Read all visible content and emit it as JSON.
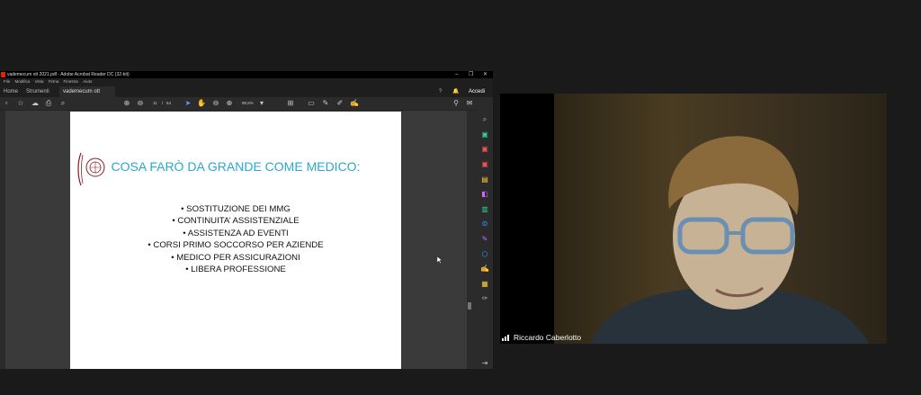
{
  "window": {
    "title": "vademecum ott 2021.pdf - Adobe Acrobat Reader DC (32-bit)",
    "controls": [
      "–",
      "❐",
      "✕"
    ]
  },
  "menu": [
    "File",
    "Modifica",
    "Vista",
    "Firma",
    "Finestra",
    "Aiuto"
  ],
  "tabs": {
    "home": "Home",
    "tools": "Strumenti",
    "document": "vademecum ott 20...",
    "close": "×",
    "signin": "Accedi"
  },
  "toolbar": {
    "page_current": "11",
    "page_sep": "/",
    "page_total": "64",
    "zoom": "85,5%"
  },
  "slide": {
    "title": "COSA FARÒ DA GRANDE COME MEDICO:",
    "bullets": [
      "SOSTITUZIONE DEI MMG",
      "CONTINUITA’ ASSISTENZIALE",
      "ASSISTENZA AD EVENTI",
      "CORSI PRIMO SOCCORSO PER AZIENDE",
      "MEDICO PER ASSICURAZIONI",
      "LIBERA PROFESSIONE"
    ]
  },
  "participant": {
    "name": "Riccardo Caberlotto"
  },
  "colors": {
    "slide_title": "#2aa7d0",
    "seal": "#8b1a1a"
  }
}
